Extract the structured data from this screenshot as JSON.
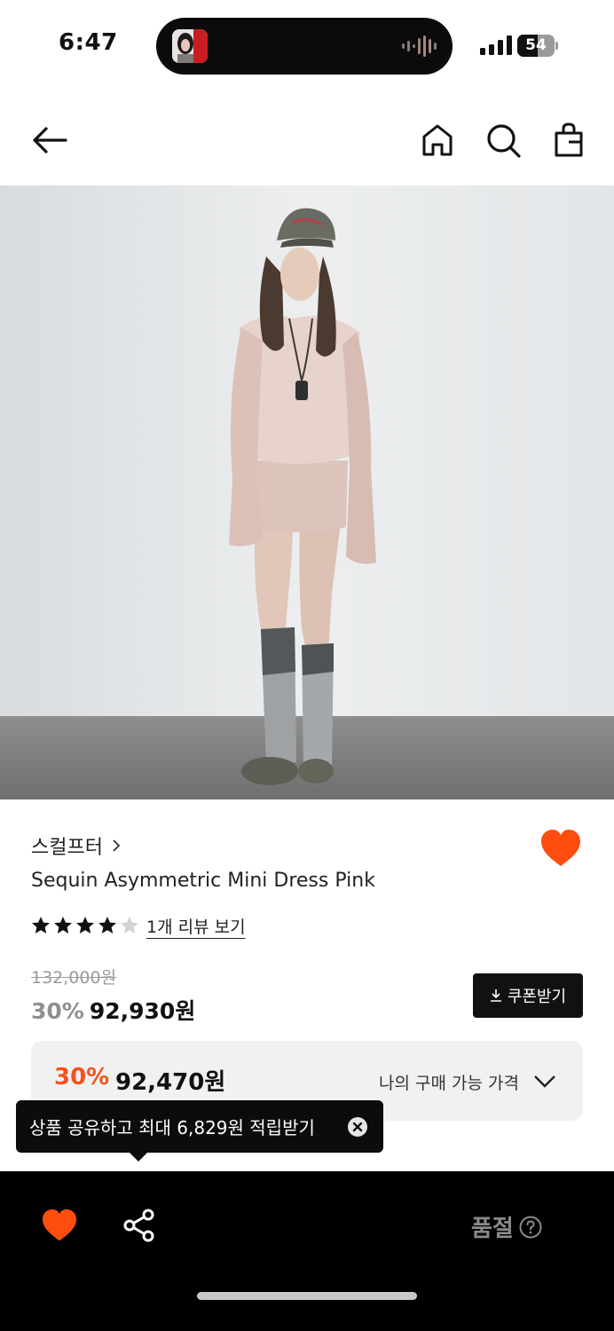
{
  "status_bar": {
    "time": "6:47",
    "battery_level": "54",
    "battery_fraction": 0.54
  },
  "header": {
    "back_icon": "arrow-left-icon",
    "home_icon": "home-icon",
    "search_icon": "search-icon",
    "bag_icon": "shopping-bag-icon"
  },
  "product": {
    "brand": "스컬프터",
    "name": "Sequin Asymmetric Mini Dress Pink",
    "rating": 4,
    "rating_max": 5,
    "review_link": "1개 리뷰 보기",
    "original_price": "132,000원",
    "discount": "30%",
    "sale_price": "92,930원",
    "wishlisted": true
  },
  "coupon": {
    "label": "쿠폰받기"
  },
  "my_price": {
    "discount": "30%",
    "price": "92,470원",
    "label": "나의 구매 가능 가격"
  },
  "tooltip": {
    "text": "상품 공유하고 최대 6,829원 적립받기"
  },
  "bottom_bar": {
    "soldout_label": "품절",
    "help_icon": "question-circle-icon",
    "share_icon": "share-icon",
    "heart_icon": "heart-icon"
  },
  "colors": {
    "accent": "#f4511e",
    "heart": "#ff4d0f",
    "dark": "#111111",
    "muted": "#8f8f8f"
  }
}
